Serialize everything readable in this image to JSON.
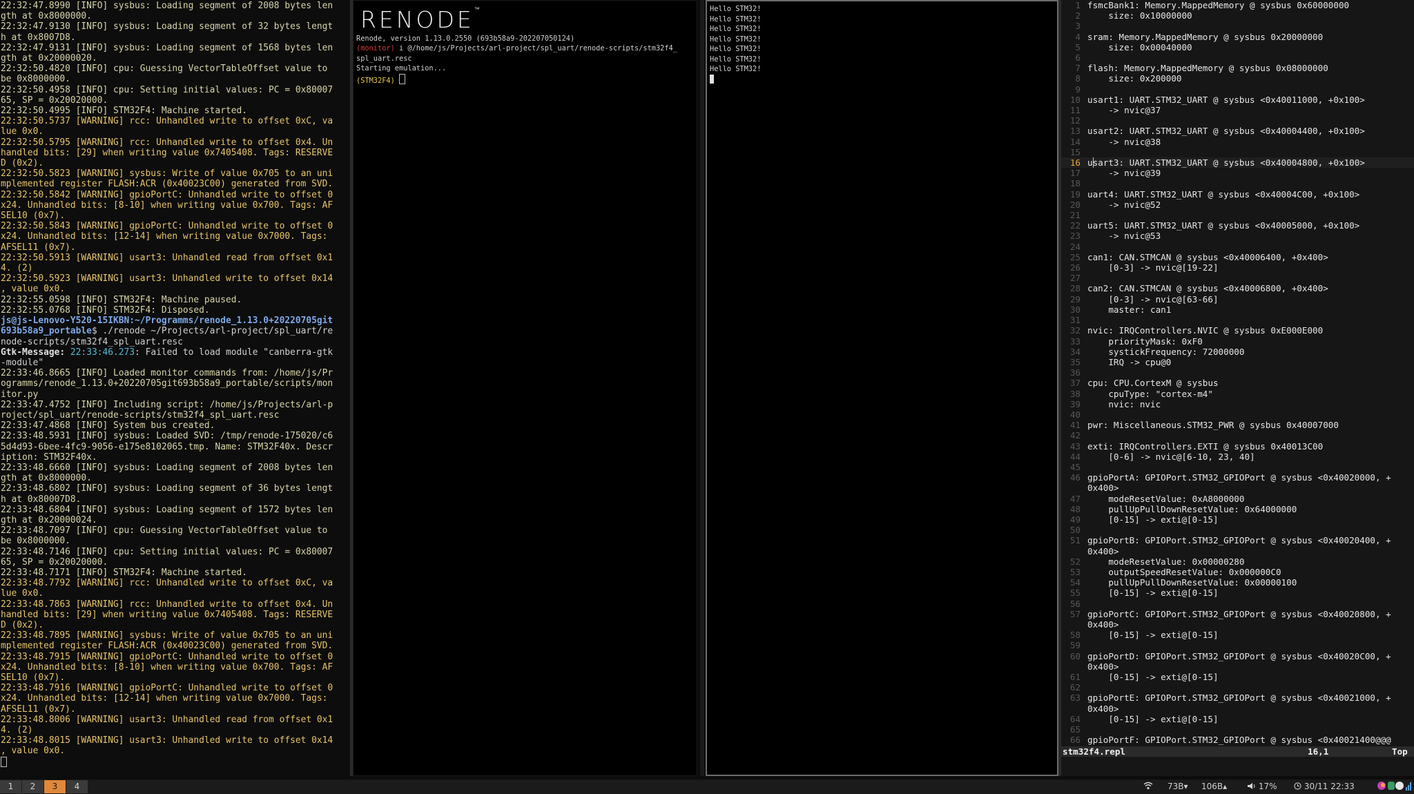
{
  "log": {
    "lines": [
      {
        "t": "22:32:47.8990 [INFO] sysbus: Loading segment of 2008 bytes len",
        "c": "info"
      },
      {
        "t": "gth at 0x8000000.",
        "c": "info"
      },
      {
        "t": "22:32:47.9130 [INFO] sysbus: Loading segment of 32 bytes lengt",
        "c": "info"
      },
      {
        "t": "h at 0x8007D8.",
        "c": "info"
      },
      {
        "t": "22:32:47.9131 [INFO] sysbus: Loading segment of 1568 bytes len",
        "c": "info"
      },
      {
        "t": "gth at 0x20000020.",
        "c": "info"
      },
      {
        "t": "22:32:50.4820 [INFO] cpu: Guessing VectorTableOffset value to",
        "c": "info"
      },
      {
        "t": "be 0x8000000.",
        "c": "info"
      },
      {
        "t": "22:32:50.4958 [INFO] cpu: Setting initial values: PC = 0x80007",
        "c": "info"
      },
      {
        "t": "65, SP = 0x20020000.",
        "c": "info"
      },
      {
        "t": "22:32:50.4995 [INFO] STM32F4: Machine started.",
        "c": "info"
      },
      {
        "t": "22:32:50.5737 [WARNING] rcc: Unhandled write to offset 0xC, va",
        "c": "warn"
      },
      {
        "t": "lue 0x0.",
        "c": "warn"
      },
      {
        "t": "22:32:50.5795 [WARNING] rcc: Unhandled write to offset 0x4. Un",
        "c": "warn"
      },
      {
        "t": "handled bits: [29] when writing value 0x7405408. Tags: RESERVE",
        "c": "warn"
      },
      {
        "t": "D (0x2).",
        "c": "warn"
      },
      {
        "t": "22:32:50.5823 [WARNING] sysbus: Write of value 0x705 to an uni",
        "c": "warn"
      },
      {
        "t": "mplemented register FLASH:ACR (0x40023C00) generated from SVD.",
        "c": "warn"
      },
      {
        "t": "22:32:50.5842 [WARNING] gpioPortC: Unhandled write to offset 0",
        "c": "warn"
      },
      {
        "t": "x24. Unhandled bits: [8-10] when writing value 0x700. Tags: AF",
        "c": "warn"
      },
      {
        "t": "SEL10 (0x7).",
        "c": "warn"
      },
      {
        "t": "22:32:50.5843 [WARNING] gpioPortC: Unhandled write to offset 0",
        "c": "warn"
      },
      {
        "t": "x24. Unhandled bits: [12-14] when writing value 0x7000. Tags:",
        "c": "warn"
      },
      {
        "t": "AFSEL11 (0x7).",
        "c": "warn"
      },
      {
        "t": "22:32:50.5913 [WARNING] usart3: Unhandled read from offset 0x1",
        "c": "warn"
      },
      {
        "t": "4. (2)",
        "c": "warn"
      },
      {
        "t": "22:32:50.5923 [WARNING] usart3: Unhandled write to offset 0x14",
        "c": "warn"
      },
      {
        "t": ", value 0x0.",
        "c": "warn"
      },
      {
        "t": "22:32:55.0598 [INFO] STM32F4: Machine paused.",
        "c": "info"
      },
      {
        "t": "22:32:55.0768 [INFO] STM32F4: Disposed.",
        "c": "info"
      },
      {
        "t": "js@js-Lenovo-Y520-15IKBN:~/Programms/renode_1.13.0+20220705git",
        "c": "user"
      },
      {
        "t": "693b58a9_portable",
        "c": "user",
        "suffix": "$ ./renode ~/Projects/arl-project/spl_uart/re"
      },
      {
        "t": "node-scripts/stm32f4_spl_uart.resc",
        "c": "host"
      },
      {
        "t": "Gtk-Message:",
        "c": "gtk",
        "time": "22:33:46.273",
        "suffix": ": Failed to load module \"canberra-gtk"
      },
      {
        "t": "-module\"",
        "c": "host"
      },
      {
        "t": "22:33:46.8665 [INFO] Loaded monitor commands from: /home/js/Pr",
        "c": "info"
      },
      {
        "t": "ogramms/renode_1.13.0+20220705git693b58a9_portable/scripts/mon",
        "c": "info"
      },
      {
        "t": "itor.py",
        "c": "info"
      },
      {
        "t": "22:33:47.4752 [INFO] Including script: /home/js/Projects/arl-p",
        "c": "info"
      },
      {
        "t": "roject/spl_uart/renode-scripts/stm32f4_spl_uart.resc",
        "c": "info"
      },
      {
        "t": "22:33:47.4868 [INFO] System bus created.",
        "c": "info"
      },
      {
        "t": "22:33:48.5931 [INFO] sysbus: Loaded SVD: /tmp/renode-175020/c6",
        "c": "info"
      },
      {
        "t": "5d4d93-6bee-4fc9-9056-e175e8102065.tmp. Name: STM32F40x. Descr",
        "c": "info"
      },
      {
        "t": "iption: STM32F40x.",
        "c": "info"
      },
      {
        "t": "22:33:48.6660 [INFO] sysbus: Loading segment of 2008 bytes len",
        "c": "info"
      },
      {
        "t": "gth at 0x8000000.",
        "c": "info"
      },
      {
        "t": "22:33:48.6802 [INFO] sysbus: Loading segment of 36 bytes lengt",
        "c": "info"
      },
      {
        "t": "h at 0x80007D8.",
        "c": "info"
      },
      {
        "t": "22:33:48.6804 [INFO] sysbus: Loading segment of 1572 bytes len",
        "c": "info"
      },
      {
        "t": "gth at 0x20000024.",
        "c": "info"
      },
      {
        "t": "22:33:48.7097 [INFO] cpu: Guessing VectorTableOffset value to",
        "c": "info"
      },
      {
        "t": "be 0x8000000.",
        "c": "info"
      },
      {
        "t": "22:33:48.7146 [INFO] cpu: Setting initial values: PC = 0x80007",
        "c": "info"
      },
      {
        "t": "65, SP = 0x20020000.",
        "c": "info"
      },
      {
        "t": "22:33:48.7171 [INFO] STM32F4: Machine started.",
        "c": "info"
      },
      {
        "t": "22:33:48.7792 [WARNING] rcc: Unhandled write to offset 0xC, va",
        "c": "warn"
      },
      {
        "t": "lue 0x0.",
        "c": "warn"
      },
      {
        "t": "22:33:48.7863 [WARNING] rcc: Unhandled write to offset 0x4. Un",
        "c": "warn"
      },
      {
        "t": "handled bits: [29] when writing value 0x7405408. Tags: RESERVE",
        "c": "warn"
      },
      {
        "t": "D (0x2).",
        "c": "warn"
      },
      {
        "t": "22:33:48.7895 [WARNING] sysbus: Write of value 0x705 to an uni",
        "c": "warn"
      },
      {
        "t": "mplemented register FLASH:ACR (0x40023C00) generated from SVD.",
        "c": "warn"
      },
      {
        "t": "22:33:48.7915 [WARNING] gpioPortC: Unhandled write to offset 0",
        "c": "warn"
      },
      {
        "t": "x24. Unhandled bits: [8-10] when writing value 0x700. Tags: AF",
        "c": "warn"
      },
      {
        "t": "SEL10 (0x7).",
        "c": "warn"
      },
      {
        "t": "22:33:48.7916 [WARNING] gpioPortC: Unhandled write to offset 0",
        "c": "warn"
      },
      {
        "t": "x24. Unhandled bits: [12-14] when writing value 0x7000. Tags:",
        "c": "warn"
      },
      {
        "t": "AFSEL11 (0x7).",
        "c": "warn"
      },
      {
        "t": "22:33:48.8006 [WARNING] usart3: Unhandled read from offset 0x1",
        "c": "warn"
      },
      {
        "t": "4. (2)",
        "c": "warn"
      },
      {
        "t": "22:33:48.8015 [WARNING] usart3: Unhandled write to offset 0x14",
        "c": "warn"
      },
      {
        "t": ", value 0x0.",
        "c": "warn"
      }
    ]
  },
  "renode": {
    "logo": "RENODE",
    "trademark": "™",
    "version_line": "Renode, version 1.13.0.2550 (693b58a9-202207050124)",
    "monitor_label": "(monitor)",
    "monitor_cmd": " i @/home/js/Projects/arl-project/spl_uart/renode-scripts/stm32f4_",
    "monitor_cmd_cont": "spl_uart.resc",
    "starting": "Starting emulation...",
    "prompt": "(STM32F4)"
  },
  "uart": {
    "lines": [
      "Hello STM32!",
      "Hello STM32!",
      "Hello STM32!",
      "Hello STM32!",
      "Hello STM32!",
      "Hello STM32!",
      "Hello STM32!"
    ]
  },
  "vim": {
    "current_line": "16",
    "rows": [
      {
        "n": "1",
        "t": "fsmcBank1: Memory.MappedMemory @ sysbus 0x60000000"
      },
      {
        "n": "2",
        "t": "    size: 0x10000000"
      },
      {
        "n": "3",
        "t": ""
      },
      {
        "n": "4",
        "t": "sram: Memory.MappedMemory @ sysbus 0x20000000"
      },
      {
        "n": "5",
        "t": "    size: 0x00040000"
      },
      {
        "n": "6",
        "t": ""
      },
      {
        "n": "7",
        "t": "flash: Memory.MappedMemory @ sysbus 0x08000000"
      },
      {
        "n": "8",
        "t": "    size: 0x200000"
      },
      {
        "n": "9",
        "t": ""
      },
      {
        "n": "10",
        "t": "usart1: UART.STM32_UART @ sysbus <0x40011000, +0x100>"
      },
      {
        "n": "11",
        "t": "    -> nvic@37"
      },
      {
        "n": "12",
        "t": ""
      },
      {
        "n": "13",
        "t": "usart2: UART.STM32_UART @ sysbus <0x40004400, +0x100>"
      },
      {
        "n": "14",
        "t": "    -> nvic@38"
      },
      {
        "n": "15",
        "t": ""
      },
      {
        "n": "16",
        "t": "usart3: UART.STM32_UART @ sysbus <0x40004800, +0x100>"
      },
      {
        "n": "17",
        "t": "    -> nvic@39"
      },
      {
        "n": "18",
        "t": ""
      },
      {
        "n": "19",
        "t": "uart4: UART.STM32_UART @ sysbus <0x40004C00, +0x100>"
      },
      {
        "n": "20",
        "t": "    -> nvic@52"
      },
      {
        "n": "21",
        "t": ""
      },
      {
        "n": "22",
        "t": "uart5: UART.STM32_UART @ sysbus <0x40005000, +0x100>"
      },
      {
        "n": "23",
        "t": "    -> nvic@53"
      },
      {
        "n": "24",
        "t": ""
      },
      {
        "n": "25",
        "t": "can1: CAN.STMCAN @ sysbus <0x40006400, +0x400>"
      },
      {
        "n": "26",
        "t": "    [0-3] -> nvic@[19-22]"
      },
      {
        "n": "27",
        "t": ""
      },
      {
        "n": "28",
        "t": "can2: CAN.STMCAN @ sysbus <0x40006800, +0x400>"
      },
      {
        "n": "29",
        "t": "    [0-3] -> nvic@[63-66]"
      },
      {
        "n": "30",
        "t": "    master: can1"
      },
      {
        "n": "31",
        "t": ""
      },
      {
        "n": "32",
        "t": "nvic: IRQControllers.NVIC @ sysbus 0xE000E000"
      },
      {
        "n": "33",
        "t": "    priorityMask: 0xF0"
      },
      {
        "n": "34",
        "t": "    systickFrequency: 72000000"
      },
      {
        "n": "35",
        "t": "    IRQ -> cpu@0"
      },
      {
        "n": "36",
        "t": ""
      },
      {
        "n": "37",
        "t": "cpu: CPU.CortexM @ sysbus"
      },
      {
        "n": "38",
        "t": "    cpuType: \"cortex-m4\""
      },
      {
        "n": "39",
        "t": "    nvic: nvic"
      },
      {
        "n": "40",
        "t": ""
      },
      {
        "n": "41",
        "t": "pwr: Miscellaneous.STM32_PWR @ sysbus 0x40007000"
      },
      {
        "n": "42",
        "t": ""
      },
      {
        "n": "43",
        "t": "exti: IRQControllers.EXTI @ sysbus 0x40013C00"
      },
      {
        "n": "44",
        "t": "    [0-6] -> nvic@[6-10, 23, 40]"
      },
      {
        "n": "45",
        "t": ""
      },
      {
        "n": "46",
        "t": "gpioPortA: GPIOPort.STM32_GPIOPort @ sysbus <0x40020000, +"
      },
      {
        "n": "",
        "t": "0x400>"
      },
      {
        "n": "47",
        "t": "    modeResetValue: 0xA8000000"
      },
      {
        "n": "48",
        "t": "    pullUpPullDownResetValue: 0x64000000"
      },
      {
        "n": "49",
        "t": "    [0-15] -> exti@[0-15]"
      },
      {
        "n": "50",
        "t": ""
      },
      {
        "n": "51",
        "t": "gpioPortB: GPIOPort.STM32_GPIOPort @ sysbus <0x40020400, +"
      },
      {
        "n": "",
        "t": "0x400>"
      },
      {
        "n": "52",
        "t": "    modeResetValue: 0x00000280"
      },
      {
        "n": "53",
        "t": "    outputSpeedResetValue: 0x000000C0"
      },
      {
        "n": "54",
        "t": "    pullUpPullDownResetValue: 0x00000100"
      },
      {
        "n": "55",
        "t": "    [0-15] -> exti@[0-15]"
      },
      {
        "n": "56",
        "t": ""
      },
      {
        "n": "57",
        "t": "gpioPortC: GPIOPort.STM32_GPIOPort @ sysbus <0x40020800, +"
      },
      {
        "n": "",
        "t": "0x400>"
      },
      {
        "n": "58",
        "t": "    [0-15] -> exti@[0-15]"
      },
      {
        "n": "59",
        "t": ""
      },
      {
        "n": "60",
        "t": "gpioPortD: GPIOPort.STM32_GPIOPort @ sysbus <0x40020C00, +"
      },
      {
        "n": "",
        "t": "0x400>"
      },
      {
        "n": "61",
        "t": "    [0-15] -> exti@[0-15]"
      },
      {
        "n": "62",
        "t": ""
      },
      {
        "n": "63",
        "t": "gpioPortE: GPIOPort.STM32_GPIOPort @ sysbus <0x40021000, +"
      },
      {
        "n": "",
        "t": "0x400>"
      },
      {
        "n": "64",
        "t": "    [0-15] -> exti@[0-15]"
      },
      {
        "n": "65",
        "t": ""
      },
      {
        "n": "66",
        "t": "gpioPortF: GPIOPort.STM32_GPIOPort @ sysbus <0x40021400@@@"
      }
    ],
    "status_file": "stm32f4.repl",
    "status_pos": "16,1",
    "status_scroll": "Top"
  },
  "taskbar": {
    "workspaces": [
      "1",
      "2",
      "3",
      "4"
    ],
    "active_workspace": "3",
    "net_down": "73B▾",
    "net_up": "106B▴",
    "volume": "17%",
    "clock": "30/11 22:33"
  },
  "colors": {
    "accent_workspace": "#e0883a",
    "warning_text": "#e6c36a",
    "info_text": "#d8d4a8",
    "prompt_user": "#7da9e8",
    "vim_current_line_number": "#e5a935"
  },
  "icons": [
    "wifi-icon",
    "volume-icon",
    "clock-icon",
    "tray-app-icons"
  ]
}
